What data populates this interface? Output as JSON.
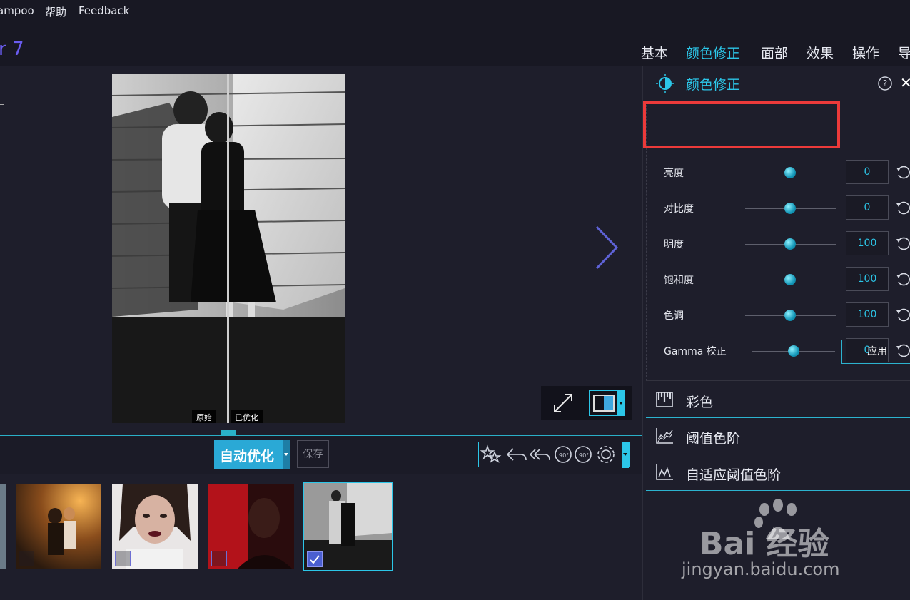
{
  "menu": {
    "app_partial": "ampoo",
    "help": "帮助",
    "feedback": "Feedback"
  },
  "app": {
    "version_partial": "r 7"
  },
  "tabs": [
    {
      "label": "基本"
    },
    {
      "label": "颜色修正",
      "active": true
    },
    {
      "label": "面部"
    },
    {
      "label": "效果"
    },
    {
      "label": "操作"
    },
    {
      "label": "导"
    }
  ],
  "preview": {
    "original_label": "原始",
    "optimized_label": "已优化"
  },
  "toolbar": {
    "auto_optimize": "自动优化",
    "save": "保存"
  },
  "thumbnails": [
    {
      "name": "couple-sunset",
      "checked": false
    },
    {
      "name": "woman-portrait",
      "checked": false
    },
    {
      "name": "man-red-portrait",
      "checked": false
    },
    {
      "name": "couple-bw",
      "checked": true,
      "selected": true
    }
  ],
  "panel": {
    "title": "颜色修正",
    "help_glyph": "?",
    "close_glyph": "✕",
    "apply": "应用",
    "sliders": [
      {
        "label": "亮度",
        "value": "0"
      },
      {
        "label": "对比度",
        "value": "0"
      },
      {
        "label": "明度",
        "value": "100"
      },
      {
        "label": "饱和度",
        "value": "100"
      },
      {
        "label": "色调",
        "value": "100"
      },
      {
        "label": "Gamma 校正",
        "value": "0"
      }
    ],
    "sections": [
      {
        "title": "彩色",
        "icon": "color-icon"
      },
      {
        "title": "阈值色阶",
        "icon": "threshold-levels-icon"
      },
      {
        "title": "自适应阈值色阶",
        "icon": "adaptive-threshold-icon"
      }
    ]
  },
  "watermark": {
    "text": "Bai 经验",
    "url": "jingyan.baidu.com"
  },
  "colors": {
    "accent": "#2cc6e8",
    "highlight": "#ec3a3a",
    "brand_purple": "#6a5cf0"
  }
}
